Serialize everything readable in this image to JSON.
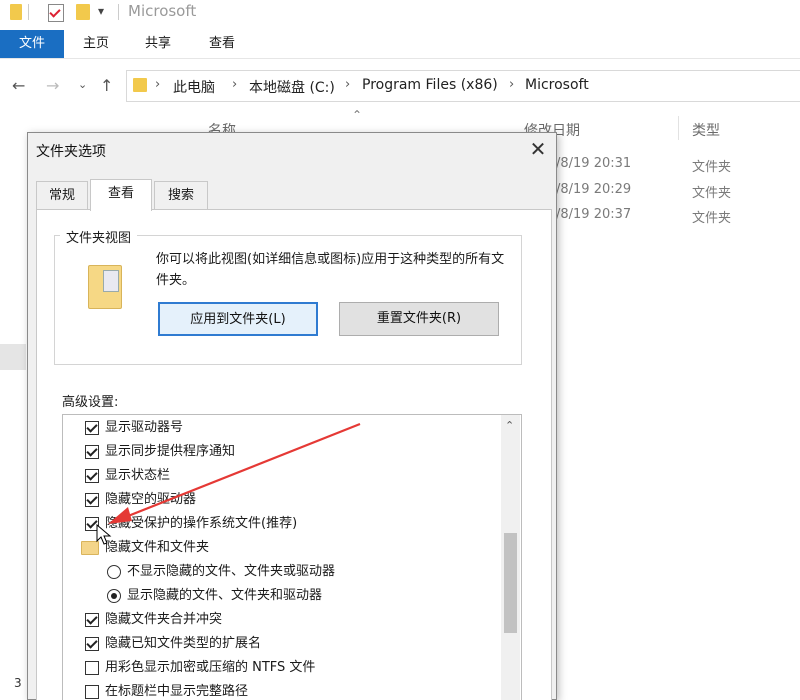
{
  "window": {
    "title": "Microsoft"
  },
  "ribbon": {
    "tabs": [
      "文件",
      "主页",
      "共享",
      "查看"
    ]
  },
  "address": {
    "crumbs": [
      "此电脑",
      "本地磁盘 (C:)",
      "Program Files (x86)",
      "Microsoft"
    ]
  },
  "columns": {
    "name": "名称",
    "date": "修改日期",
    "type": "类型"
  },
  "files": [
    {
      "date": "/8/19 20:31",
      "type": "文件夹"
    },
    {
      "date": "/8/19 20:29",
      "type": "文件夹"
    },
    {
      "date": "/8/19 20:37",
      "type": "文件夹"
    }
  ],
  "status": {
    "count": "3"
  },
  "dialog": {
    "title": "文件夹选项",
    "close": "✕",
    "tabs": [
      "常规",
      "查看",
      "搜索"
    ],
    "active_tab": "查看",
    "folder_view": {
      "title": "文件夹视图",
      "description": "你可以将此视图(如详细信息或图标)应用于这种类型的所有文件夹。",
      "apply_button": "应用到文件夹(L)",
      "reset_button": "重置文件夹(R)"
    },
    "advanced": {
      "label": "高级设置:",
      "items": [
        {
          "kind": "checkbox",
          "checked": true,
          "label": "显示驱动器号"
        },
        {
          "kind": "checkbox",
          "checked": true,
          "label": "显示同步提供程序通知"
        },
        {
          "kind": "checkbox",
          "checked": true,
          "label": "显示状态栏"
        },
        {
          "kind": "checkbox",
          "checked": true,
          "label": "隐藏空的驱动器"
        },
        {
          "kind": "checkbox",
          "checked": true,
          "label": "隐藏受保护的操作系统文件(推荐)"
        },
        {
          "kind": "folder",
          "label": "隐藏文件和文件夹"
        },
        {
          "kind": "radio",
          "checked": false,
          "label": "不显示隐藏的文件、文件夹或驱动器"
        },
        {
          "kind": "radio",
          "checked": true,
          "label": "显示隐藏的文件、文件夹和驱动器"
        },
        {
          "kind": "checkbox",
          "checked": true,
          "label": "隐藏文件夹合并冲突"
        },
        {
          "kind": "checkbox",
          "checked": true,
          "label": "隐藏已知文件类型的扩展名"
        },
        {
          "kind": "checkbox",
          "checked": false,
          "label": "用彩色显示加密或压缩的 NTFS 文件"
        },
        {
          "kind": "checkbox",
          "checked": false,
          "label": "在标题栏中显示完整路径"
        }
      ]
    }
  },
  "colors": {
    "accent": "#1a6ec2",
    "annotation_arrow": "#e53935"
  }
}
